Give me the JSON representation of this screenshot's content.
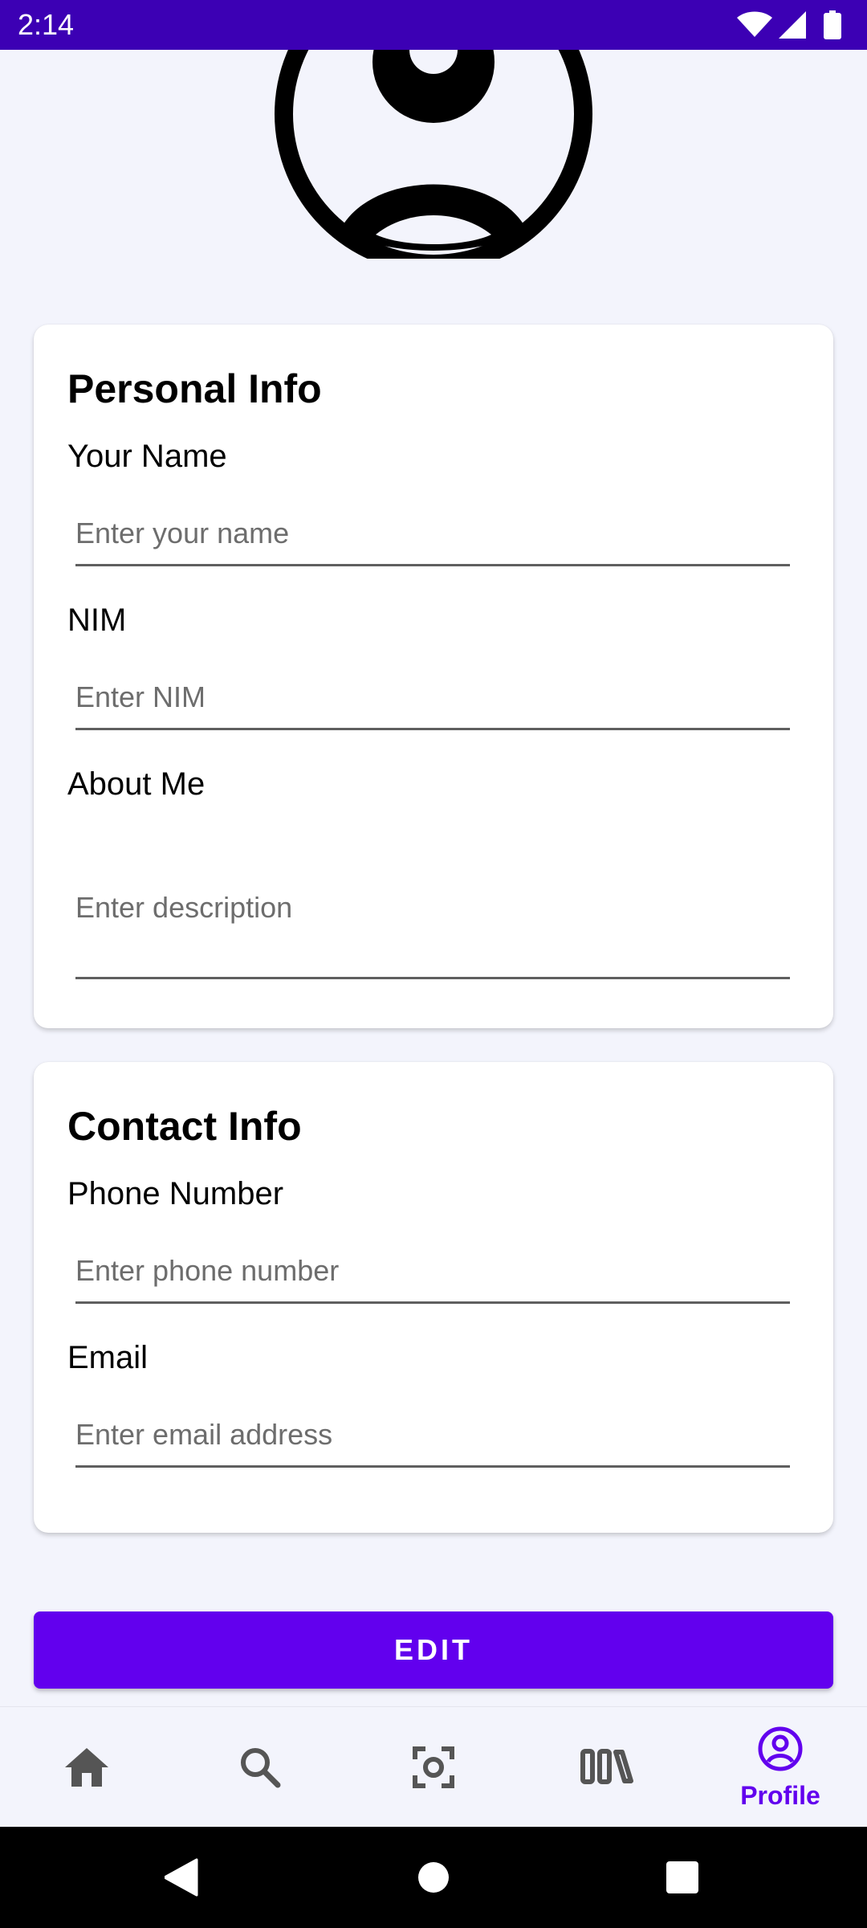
{
  "status_bar": {
    "time": "2:14",
    "icons": [
      "wifi-icon",
      "signal-icon",
      "battery-icon"
    ],
    "background_color": "#3c00b4"
  },
  "avatar": {
    "icon": "account-circle-icon"
  },
  "personal_info": {
    "title": "Personal Info",
    "name_label": "Your Name",
    "name_placeholder": "Enter your name",
    "nim_label": "NIM",
    "nim_placeholder": "Enter NIM",
    "about_label": "About Me",
    "about_placeholder": "Enter description"
  },
  "contact_info": {
    "title": "Contact Info",
    "phone_label": "Phone Number",
    "phone_placeholder": "Enter phone number",
    "email_label": "Email",
    "email_placeholder": "Enter email address"
  },
  "edit_button": {
    "label": "EDIT",
    "color": "#6200ee"
  },
  "bottom_nav": {
    "items": [
      {
        "icon": "home-icon",
        "label": ""
      },
      {
        "icon": "search-icon",
        "label": ""
      },
      {
        "icon": "scan-icon",
        "label": ""
      },
      {
        "icon": "library-icon",
        "label": ""
      },
      {
        "icon": "profile-icon",
        "label": "Profile",
        "selected": true
      }
    ],
    "active_color": "#6200ee",
    "inactive_color": "#555555"
  },
  "system_nav": {
    "icons": [
      "back-icon",
      "home-circle-icon",
      "recents-icon"
    ]
  }
}
